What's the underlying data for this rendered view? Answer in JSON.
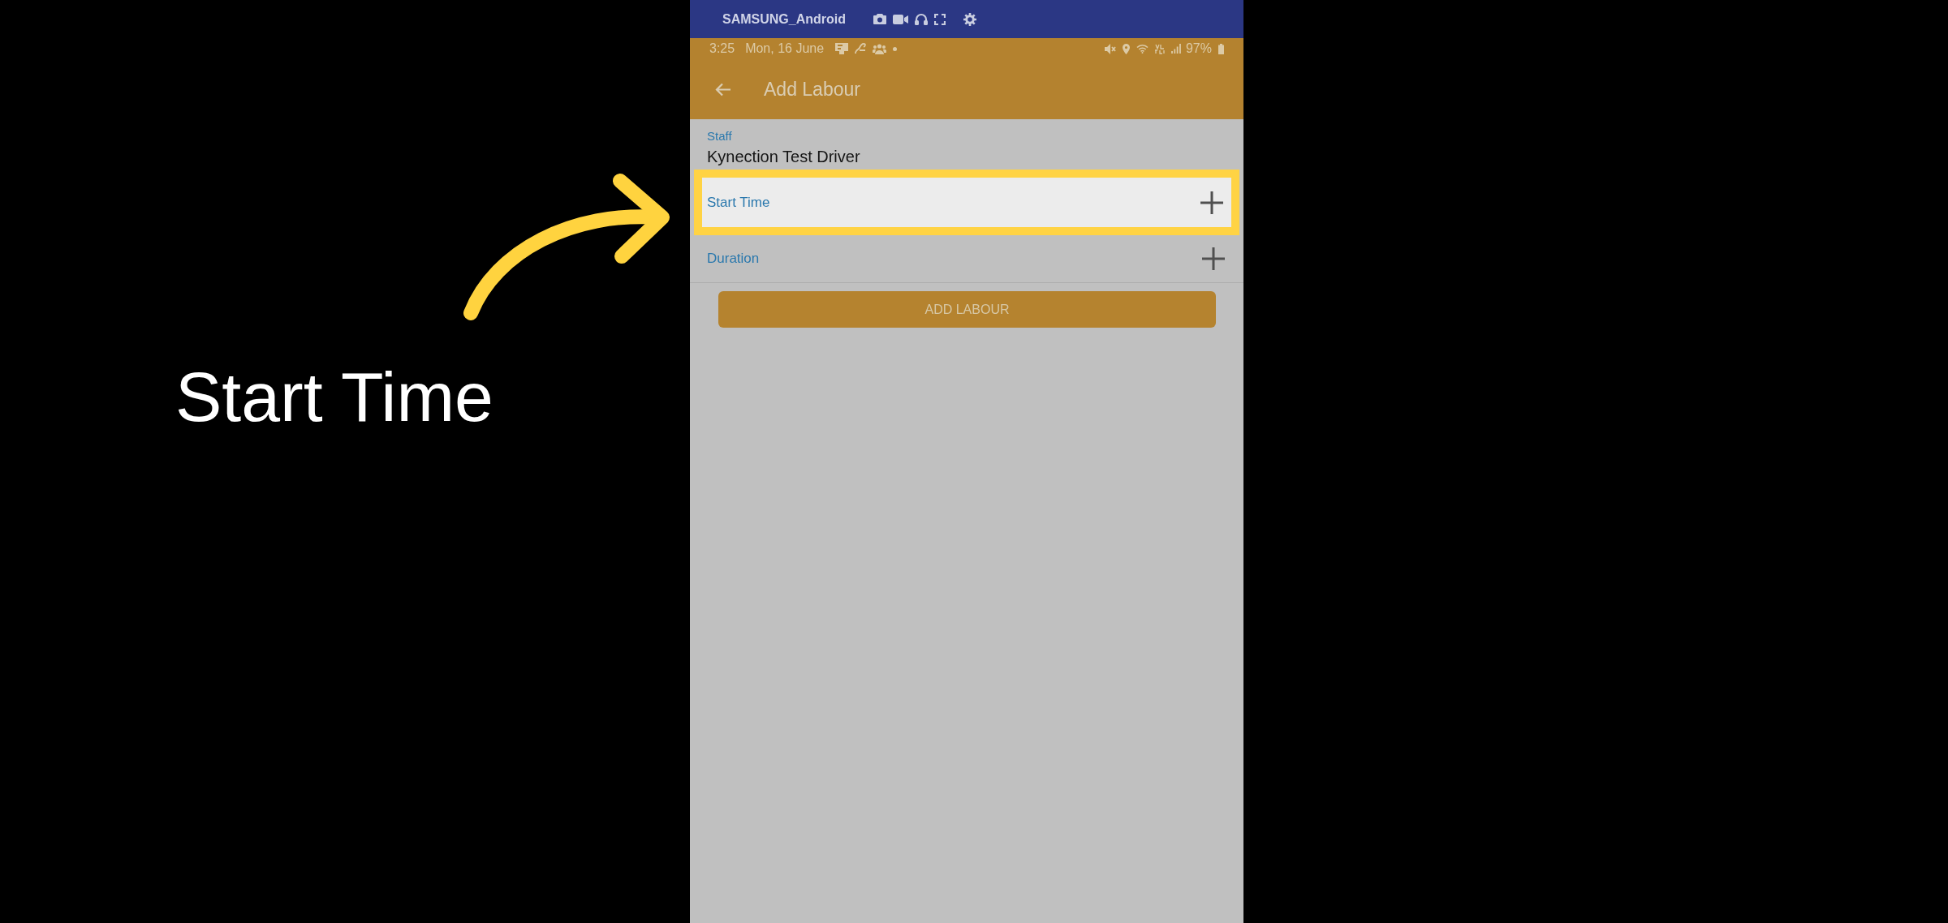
{
  "annotation": {
    "label": "Start Time"
  },
  "emulator_bar": {
    "title": "SAMSUNG_Android"
  },
  "status_bar": {
    "time": "3:25",
    "date": "Mon, 16 June",
    "battery": "97%"
  },
  "app_bar": {
    "title": "Add Labour"
  },
  "form": {
    "staff": {
      "label": "Staff",
      "value": "Kynection Test Driver"
    },
    "rows": [
      {
        "label": "Start Time",
        "highlighted": true
      },
      {
        "label": "Duration",
        "highlighted": false
      }
    ]
  },
  "button": {
    "label": "ADD LABOUR"
  }
}
